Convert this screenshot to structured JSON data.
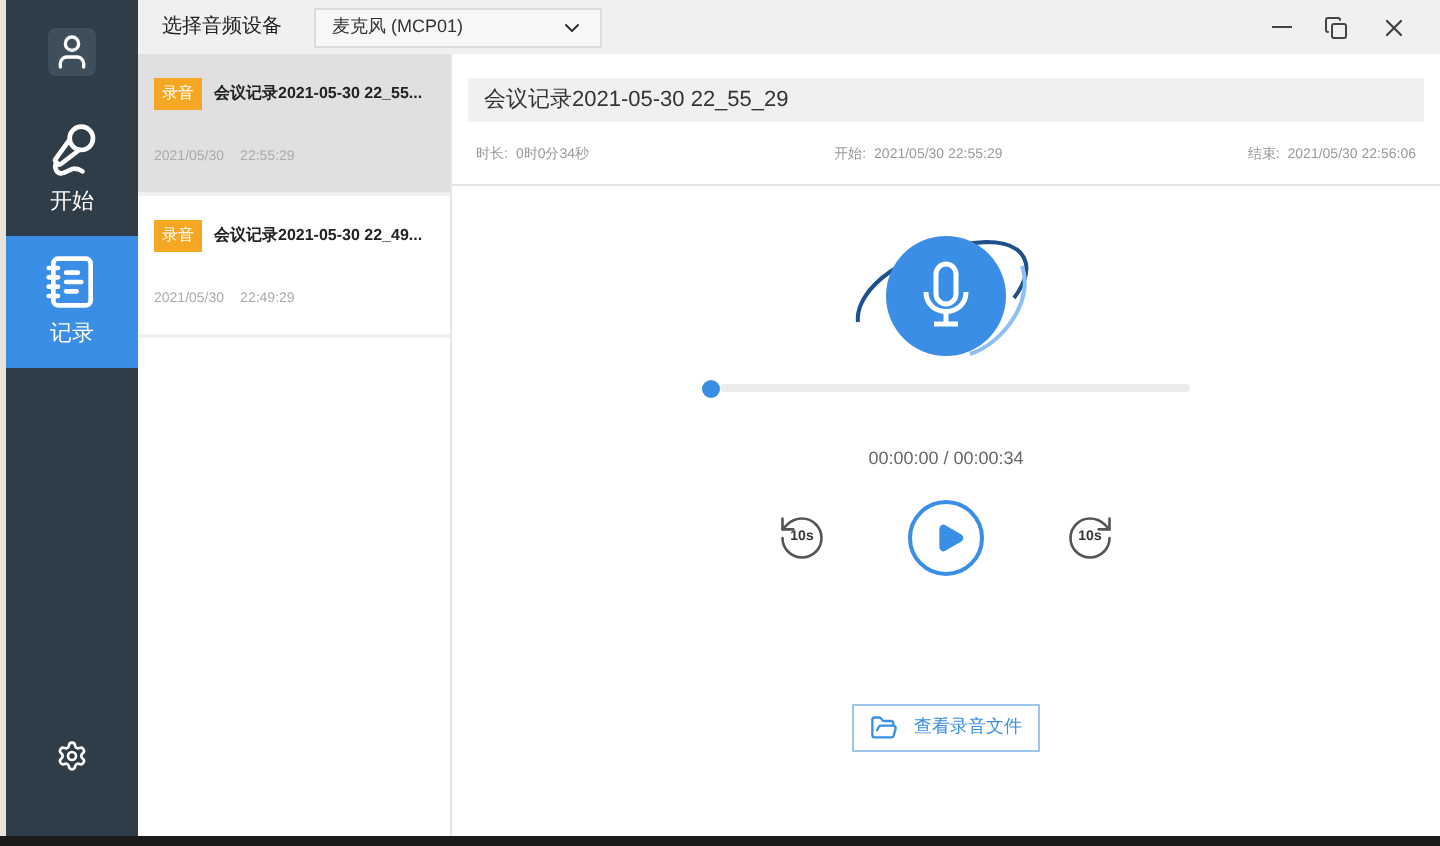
{
  "sidebar": {
    "items": [
      {
        "kind": "avatar",
        "selected": false
      },
      {
        "kind": "start",
        "label": "开始",
        "selected": false
      },
      {
        "kind": "records",
        "label": "记录",
        "selected": true
      },
      {
        "kind": "settings",
        "selected": false
      }
    ]
  },
  "toolbar": {
    "device_label": "选择音频设备",
    "device_value": "麦克风 (MCP01)"
  },
  "records": [
    {
      "tag": "录音",
      "title": "会议记录2021-05-30 22_55...",
      "date": "2021/05/30",
      "time": "22:55:29",
      "selected": true
    },
    {
      "tag": "录音",
      "title": "会议记录2021-05-30 22_49...",
      "date": "2021/05/30",
      "time": "22:49:29",
      "selected": false
    }
  ],
  "detail": {
    "title": "会议记录2021-05-30 22_55_29",
    "duration_label": "时长:",
    "duration": "0时0分34秒",
    "start_label": "开始:",
    "start": "2021/05/30 22:55:29",
    "end_label": "结束:",
    "end": "2021/05/30 22:56:06"
  },
  "player": {
    "level": 0,
    "time": "00:00:00 / 00:00:34",
    "rewind": "10s",
    "forward": "10s"
  },
  "open_folder_button": "查看录音文件"
}
